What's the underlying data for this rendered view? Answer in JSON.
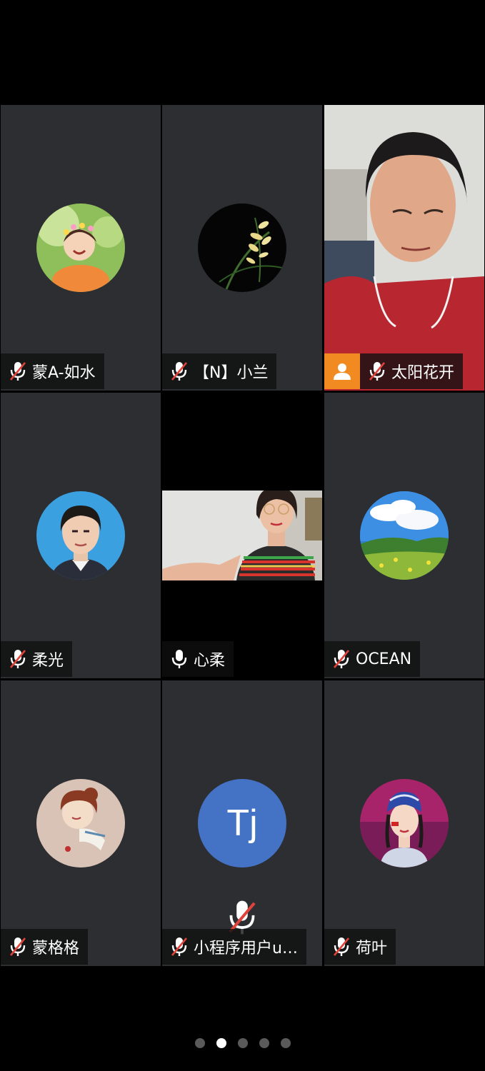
{
  "participants": [
    {
      "name": "蒙A-如水",
      "mic": "muted",
      "avatar": "girl-flower-crown-avatar"
    },
    {
      "name": "【N】小兰",
      "mic": "muted",
      "avatar": "orchid-avatar"
    },
    {
      "name": "太阳花开",
      "mic": "muted",
      "avatar": "live-video",
      "host_badge": "person-icon"
    },
    {
      "name": "柔光",
      "mic": "muted",
      "avatar": "woman-portrait-avatar"
    },
    {
      "name": "心柔",
      "mic": "active",
      "avatar": "live-video"
    },
    {
      "name": "OCEAN",
      "mic": "muted",
      "avatar": "landscape-avatar"
    },
    {
      "name": "蒙格格",
      "mic": "muted",
      "avatar": "cartoon-girl-avatar"
    },
    {
      "name": "小程序用户u…",
      "mic": "muted",
      "avatar_initials": "Tj"
    },
    {
      "name": "荷叶",
      "mic": "muted",
      "avatar": "girl-headdress-avatar"
    }
  ],
  "pagination": {
    "total": 5,
    "current": 2
  },
  "colors": {
    "tile_bg": "#2c2e31",
    "host_badge": "#f08a21",
    "tj_avatar": "#4472c4",
    "mute_slash": "#e0433b"
  }
}
